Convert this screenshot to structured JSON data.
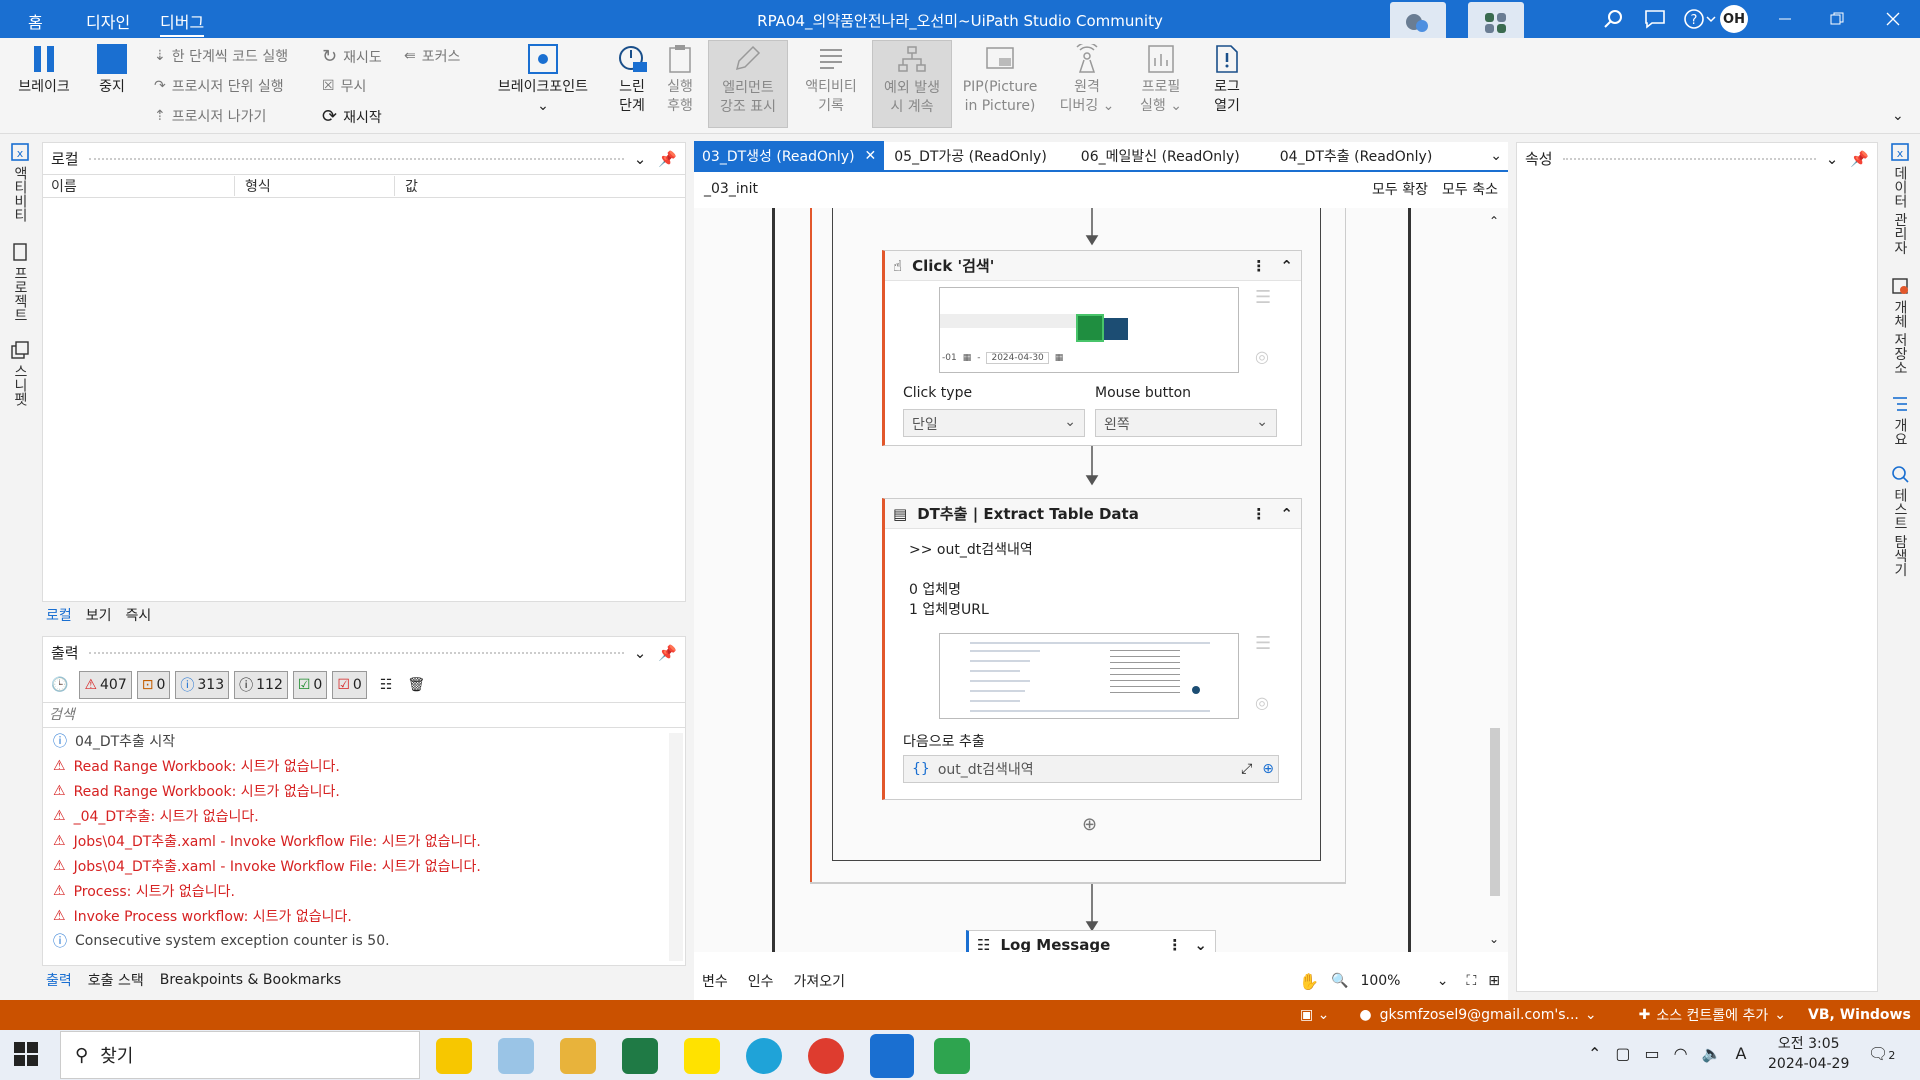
{
  "titlebar": {
    "menu": [
      "홈",
      "디자인",
      "디버그"
    ],
    "title": "RPA04_의약품안전나라_오선미~UiPath Studio Community",
    "avatar": "OH"
  },
  "ribbon": {
    "break": "브레이크",
    "stop": "중지",
    "step_into": "한 단계씩 코드 실행",
    "step_over": "프로시저 단위 실행",
    "step_out": "프로시저 나가기",
    "retry": "재시도",
    "ignore": "무시",
    "restart": "재시작",
    "focus": "포커스",
    "breakpoints": "브레이크포인트",
    "slow_step_1": "느린",
    "slow_step_2": "단계",
    "run_after_1": "실행",
    "run_after_2": "후행",
    "highlight_1": "엘리먼트",
    "highlight_2": "강조 표시",
    "activity_log_1": "액티비티",
    "activity_log_2": "기록",
    "continue_ex_1": "예외 발생",
    "continue_ex_2": "시 계속",
    "pip_1": "PIP(Picture",
    "pip_2": "in Picture)",
    "remote_1": "원격",
    "remote_2": "디버깅",
    "profile_1": "프로필",
    "profile_2": "실행",
    "log_1": "로그",
    "log_2": "열기"
  },
  "left_rail": [
    "액티비티",
    "프로젝트",
    "스니펫"
  ],
  "right_rail": [
    "데이터 관리자",
    "개체 저장소",
    "개요",
    "테스트 탐색기"
  ],
  "locals": {
    "title": "로컬",
    "columns": [
      "이름",
      "형식",
      "값"
    ],
    "tabs": [
      "로컬",
      "보기",
      "즉시"
    ]
  },
  "output": {
    "title": "출력",
    "counts": {
      "warn": "407",
      "err": "0",
      "info": "313",
      "trace": "112",
      "ok": "0",
      "fail": "0"
    },
    "search_placeholder": "검색",
    "lines": [
      {
        "type": "info",
        "text": "04_DT추출 시작"
      },
      {
        "type": "err",
        "text": "Read Range Workbook: 시트가 없습니다."
      },
      {
        "type": "err",
        "text": "Read Range Workbook: 시트가 없습니다."
      },
      {
        "type": "err",
        "text": "_04_DT추출: 시트가 없습니다."
      },
      {
        "type": "err",
        "text": "Jobs\\04_DT추출.xaml - Invoke Workflow File: 시트가 없습니다."
      },
      {
        "type": "err",
        "text": "Jobs\\04_DT추출.xaml - Invoke Workflow File: 시트가 없습니다."
      },
      {
        "type": "err",
        "text": "Process: 시트가 없습니다."
      },
      {
        "type": "err",
        "text": "Invoke Process workflow: 시트가 없습니다."
      },
      {
        "type": "info",
        "text": "Consecutive system exception counter is 50."
      }
    ],
    "bottom_tabs": [
      "출력",
      "호출 스택",
      "Breakpoints & Bookmarks"
    ]
  },
  "designer": {
    "tabs": [
      "03_DT생성 (ReadOnly)",
      "05_DT가공 (ReadOnly)",
      "06_메일발신 (ReadOnly)",
      "04_DT추출 (ReadOnly)"
    ],
    "breadcrumb": "_03_init",
    "expand_all": "모두 확장",
    "collapse_all": "모두 축소",
    "click_card": {
      "title": "Click '검색'",
      "preview_date_left": "-01",
      "preview_date_right": "2024-04-30",
      "click_type_label": "Click type",
      "click_type_value": "단일",
      "mouse_button_label": "Mouse button",
      "mouse_button_value": "왼쪽"
    },
    "extract_card": {
      "title": "DT추출 | Extract Table Data",
      "output": ">> out_dt검색내역",
      "col0": "0 업체명",
      "col1": "1 업체명URL",
      "extract_to_label": "다음으로 추출",
      "extract_to_value": "out_dt검색내역"
    },
    "log_card": {
      "title": "Log Message"
    },
    "bottom_tabs": [
      "변수",
      "인수",
      "가져오기"
    ],
    "zoom": "100%"
  },
  "properties": {
    "title": "속성"
  },
  "statusbar": {
    "account": "gksmfzosel9@gmail.com's...",
    "source_control": "소스 컨트롤에 추가",
    "lang": "VB, Windows"
  },
  "taskbar": {
    "search": "찾기",
    "time": "오전 3:05",
    "date": "2024-04-29",
    "ime": "A",
    "notif": "2"
  }
}
